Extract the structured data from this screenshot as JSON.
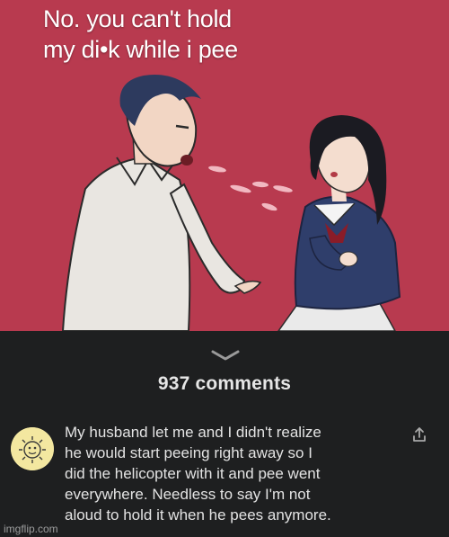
{
  "caption": {
    "line1": "No. you can't hold",
    "line2": "my di•k while i pee"
  },
  "comments": {
    "count_label": "937 comments"
  },
  "comment": {
    "lines": [
      "My husband let me and I didn't realize",
      "he would start peeing right away so I",
      "did the helicopter with it and pee went",
      "everywhere. Needless to say I'm not",
      "aloud to hold it when he pees anymore."
    ]
  },
  "watermark": "imgflip.com",
  "colors": {
    "panel_background": "#b83a4f",
    "dark_background": "#1e1f20",
    "avatar_yellow": "#f3e7a0"
  },
  "icons": {
    "collapse": "chevron-down-icon",
    "share": "share-arrow-icon",
    "avatar": "sun-face-icon"
  }
}
